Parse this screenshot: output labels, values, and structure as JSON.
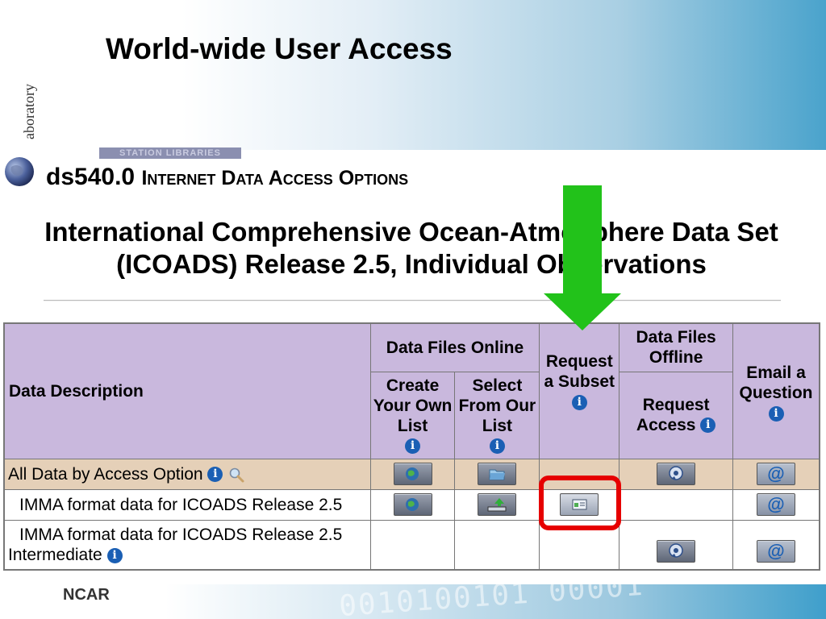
{
  "slide": {
    "title": "World-wide User Access",
    "side_text": "aboratory",
    "footer_label": "NCAR",
    "footer_bits": "0010100101 00001"
  },
  "page": {
    "station_tab": "STATION LIBRARIES",
    "ds_number": "ds540.0",
    "ds_heading": "Internet Data Access Options",
    "dataset_title_line1": "International Comprehensive Ocean-Atmosphere Data Set",
    "dataset_title_line2": "(ICOADS) Release 2.5, Individual Observations"
  },
  "table": {
    "headers": {
      "data_description": "Data Description",
      "data_files_online": "Data Files Online",
      "create_your_own_list": "Create Your Own List",
      "select_from_our_list": "Select From Our List",
      "request_a_subset": "Request a Subset",
      "data_files_offline": "Data Files Offline",
      "request_access": "Request Access",
      "email_a_question": "Email a Question"
    },
    "rows": [
      {
        "description": "All Data by Access Option"
      },
      {
        "description": "IMMA format data for ICOADS Release 2.5"
      },
      {
        "description": "IMMA format data for ICOADS Release 2.5 Intermediate"
      }
    ]
  },
  "icons": {
    "info": "i",
    "email_at": "@"
  },
  "colors": {
    "header_bg": "#c9b8dd",
    "all_row_bg": "#e5d0b8",
    "highlight_red": "#e60000",
    "arrow_green": "#22c21a",
    "info_blue": "#1a5fb4"
  }
}
